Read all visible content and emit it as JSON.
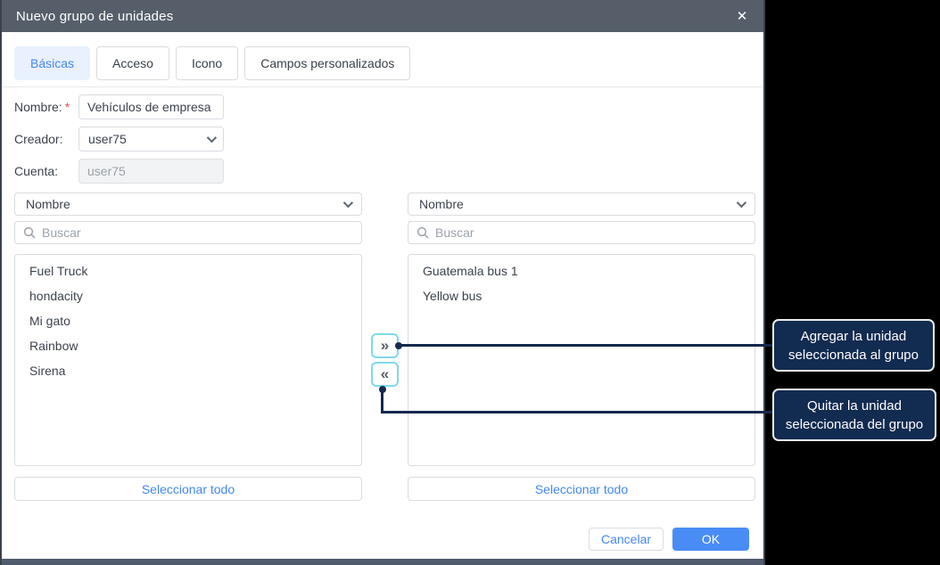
{
  "dialog": {
    "title": "Nuevo grupo de unidades",
    "close_icon": "✕",
    "tabs": [
      {
        "label": "Básicas",
        "active": true
      },
      {
        "label": "Acceso",
        "active": false
      },
      {
        "label": "Icono",
        "active": false
      },
      {
        "label": "Campos personalizados",
        "active": false
      }
    ],
    "form": {
      "name_label": "Nombre:",
      "required_mark": "*",
      "name_value": "Vehículos de empresa",
      "creator_label": "Creador:",
      "creator_value": "user75",
      "account_label": "Cuenta:",
      "account_value": "user75"
    },
    "left_panel": {
      "filter_value": "Nombre",
      "search_placeholder": "Buscar",
      "items": [
        "Fuel Truck",
        "hondacity",
        "Mi gato",
        "Rainbow",
        "Sirena"
      ],
      "select_all_label": "Seleccionar todo"
    },
    "right_panel": {
      "filter_value": "Nombre",
      "search_placeholder": "Buscar",
      "items": [
        "Guatemala bus 1",
        "Yellow bus"
      ],
      "select_all_label": "Seleccionar todo"
    },
    "transfer": {
      "add_glyph": "»",
      "remove_glyph": "«"
    },
    "footer": {
      "cancel_label": "Cancelar",
      "ok_label": "OK"
    }
  },
  "annotations": {
    "add": {
      "text": "Agregar la unidad seleccionada al grupo"
    },
    "remove": {
      "text": "Quitar la unidad seleccionada del grupo"
    }
  },
  "colors": {
    "titlebar": "#565f69",
    "accent_blue": "#4487f6",
    "active_tab_bg": "#e8f1fd",
    "highlight_cyan": "#7ed9ec",
    "callout_navy": "#15294d",
    "annotation_bg": "#122b50",
    "required_red": "#e05252"
  }
}
